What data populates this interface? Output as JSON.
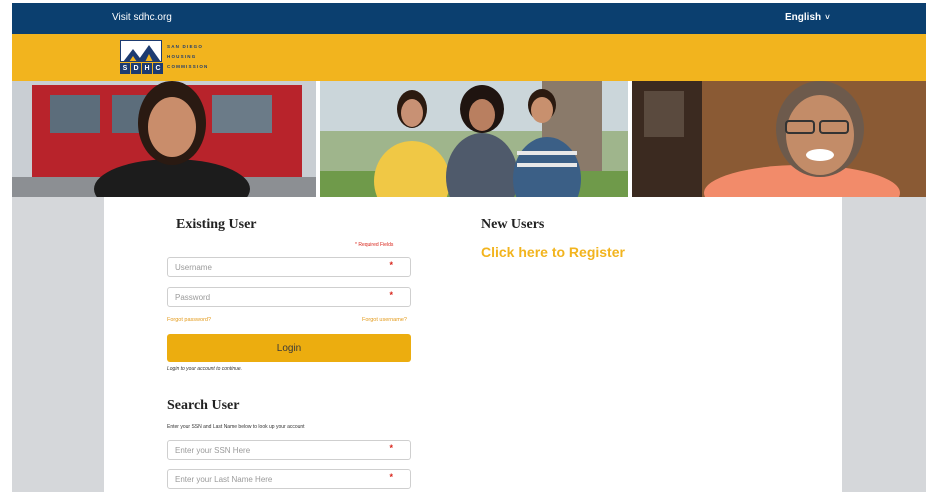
{
  "top_bar": {
    "visit_link": "Visit sdhc.org",
    "language": "English",
    "language_caret": "˅"
  },
  "logo": {
    "letters": [
      "S",
      "D",
      "H",
      "C"
    ],
    "words": [
      "SAN DIEGO",
      "HOUSING",
      "COMMISSION"
    ]
  },
  "existing_user": {
    "heading": "Existing User",
    "required_note": "* Required Fields",
    "username_placeholder": "Username",
    "password_placeholder": "Password",
    "required_marker": "*",
    "forgot_password": "Forgot password?",
    "forgot_username": "Forgot username?",
    "login_label": "Login",
    "login_hint": "Login to your account to continue."
  },
  "search_user": {
    "heading": "Search User",
    "hint": "Enter your SSN and Last Name below to look up your account",
    "ssn_placeholder": "Enter your SSN Here",
    "lastname_placeholder": "Enter your Last Name Here",
    "required_marker": "*"
  },
  "new_users": {
    "heading": "New Users",
    "register_link": "Click here to Register"
  },
  "colors": {
    "top_bar": "#0b3f6f",
    "brand_yellow": "#f2b41e",
    "login_button": "#ecad0f",
    "required": "#d9261c",
    "link_orange": "#e39a1a"
  }
}
